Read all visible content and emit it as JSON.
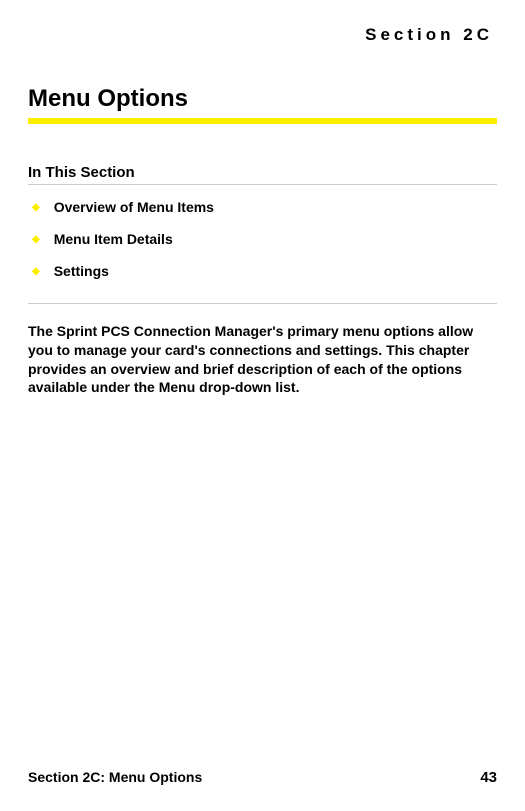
{
  "section_label": "Section 2C",
  "title": "Menu Options",
  "in_this_section_heading": "In This Section",
  "toc": {
    "items": [
      {
        "label": "Overview of Menu Items"
      },
      {
        "label": "Menu Item Details"
      },
      {
        "label": "Settings"
      }
    ]
  },
  "body_paragraph": "The Sprint PCS Connection Manager's primary menu options allow you to manage your card's connections and settings. This chapter provides an overview and brief description of each of the options available under the Menu drop-down list.",
  "footer": {
    "left": "Section 2C: Menu Options",
    "page_number": "43"
  }
}
